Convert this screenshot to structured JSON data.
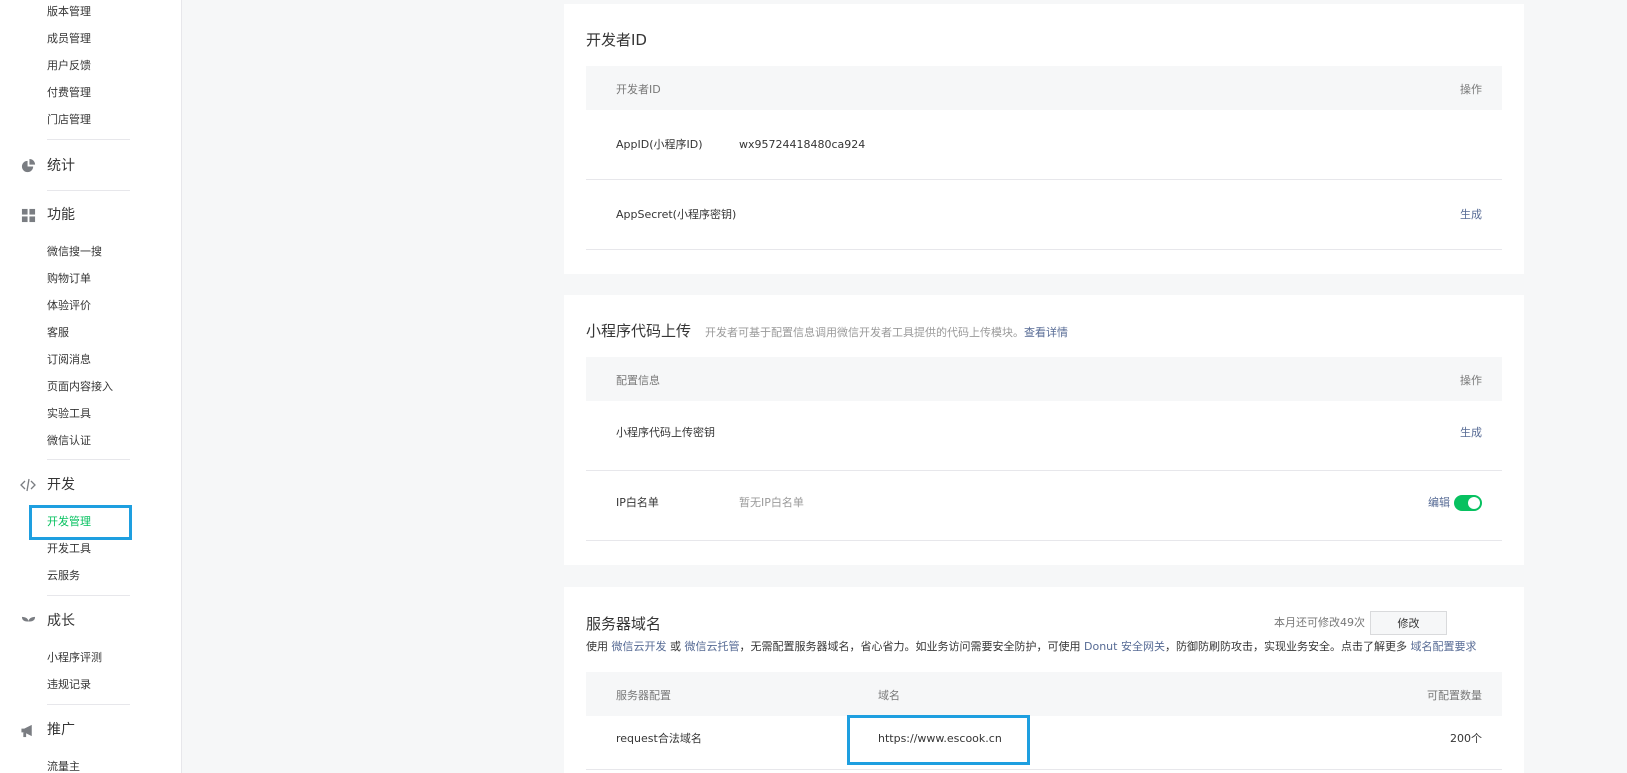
{
  "sidebar": {
    "top_items": [
      "版本管理",
      "成员管理",
      "用户反馈",
      "付费管理",
      "门店管理"
    ],
    "groups": {
      "stats": "统计",
      "features": "功能",
      "dev": "开发",
      "growth": "成长",
      "promo": "推广"
    },
    "feature_items": [
      "微信搜一搜",
      "购物订单",
      "体验评价",
      "客服",
      "订阅消息",
      "页面内容接入",
      "实验工具",
      "微信认证"
    ],
    "dev_items": [
      "开发管理",
      "开发工具",
      "云服务"
    ],
    "growth_items": [
      "小程序评测",
      "违规记录"
    ],
    "promo_items": [
      "流量主"
    ]
  },
  "dev_id_card": {
    "title": "开发者ID",
    "col_name": "开发者ID",
    "col_action": "操作",
    "appid_label": "AppID(小程序ID)",
    "appid_value": "wx95724418480ca924",
    "secret_label": "AppSecret(小程序密钥)",
    "secret_action": "生成"
  },
  "upload_card": {
    "title": "小程序代码上传",
    "subtitle": "开发者可基于配置信息调用微信开发者工具提供的代码上传模块。",
    "subtitle_link": "查看详情",
    "col_config": "配置信息",
    "col_action": "操作",
    "key_label": "小程序代码上传密钥",
    "key_action": "生成",
    "ip_label": "IP白名单",
    "ip_value": "暂无IP白名单",
    "ip_action": "编辑"
  },
  "server_card": {
    "title": "服务器域名",
    "remaining": "本月还可修改49次",
    "modify_btn": "修改",
    "note_1": "使用",
    "note_link_1": "微信云开发",
    "note_2": "或",
    "note_link_2": "微信云托管",
    "note_3": "，无需配置服务器域名，省心省力。如业务访问需要安全防护，可使用",
    "note_link_3": "Donut 安全网关",
    "note_4": "，防御防刷防攻击，实现业务安全。点击了解更多",
    "note_link_4": "域名配置要求",
    "col_config": "服务器配置",
    "col_domain": "域名",
    "col_count": "可配置数量",
    "row_label": "request合法域名",
    "row_domain": "https://www.escook.cn",
    "row_count": "200个"
  },
  "colors": {
    "accent_green": "#07c160",
    "link_blue": "#576b95",
    "highlight_box": "#1e9fe0"
  }
}
